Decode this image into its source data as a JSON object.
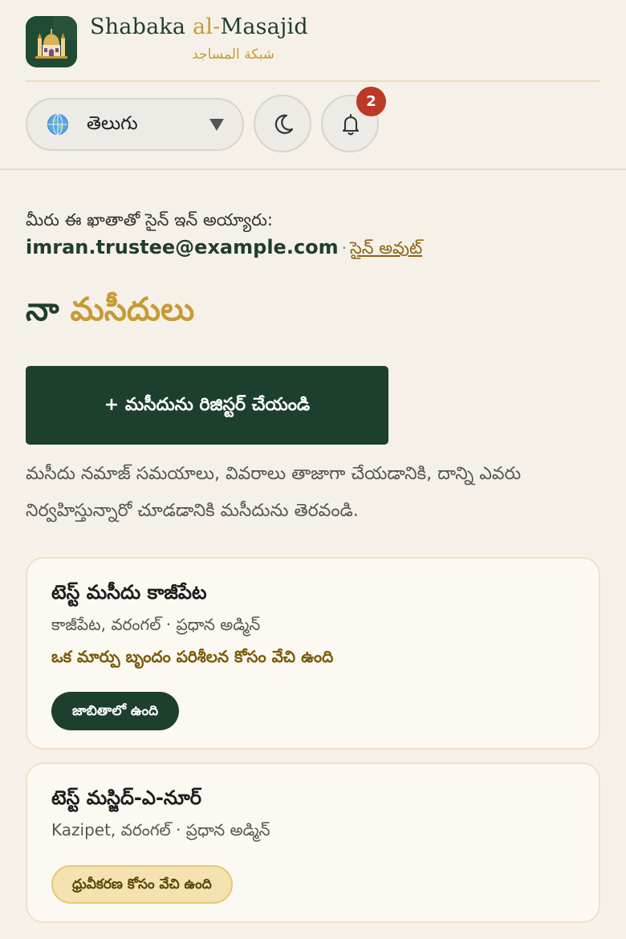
{
  "brand": {
    "name_prefix": "Shabaka ",
    "name_accent": "al-",
    "name_suffix": "Masajid",
    "arabic": "شبكة المساجد"
  },
  "header": {
    "language": {
      "selected": "తెలుగు",
      "icon": "globe-icon"
    },
    "theme_icon": "moon-icon",
    "notifications": {
      "icon": "bell-icon",
      "count": "2"
    }
  },
  "account": {
    "signed_in_text": "మీరు ఈ ఖాతాతో సైన్ ఇన్ అయ్యారు:",
    "email": "imran.trustee@example.com",
    "separator": "·",
    "sign_out": "సైన్ అవుట్"
  },
  "page": {
    "title_prefix": "నా ",
    "title_accent": "మసీదులు",
    "register_button": "+ మసీదును రిజిస్టర్ చేయండి",
    "intro": "మసీదు నమాజ్ సమయాలు, వివరాలు తాజాగా చేయడానికి, దాన్ని ఎవరు నిర్వహిస్తున్నారో చూడడానికి మసీదును తెరవండి."
  },
  "mosques": [
    {
      "name": "టెస్ట్ మసీదు కాజీపేట",
      "meta": "కాజీపేట, వరంగల్ · ప్రధాన అడ్మిన్",
      "note": "ఒక మార్పు బృందం పరిశీలన కోసం వేచి ఉంది",
      "status": "జాబితాలో ఉంది"
    },
    {
      "name": "టెస్ట్ మస్జిద్-ఎ-నూర్",
      "meta": "Kazipet, వరంగల్ · ప్రధాన అడ్మిన్",
      "status": "ధ్రువీకరణ కోసం వేచి ఉంది"
    }
  ],
  "colors": {
    "background": "#f6f1e8",
    "primary_green": "#1d3f2d",
    "accent_gold": "#c79a35",
    "badge_red": "#bb3a26",
    "pending_bg": "#f4e3b0"
  }
}
